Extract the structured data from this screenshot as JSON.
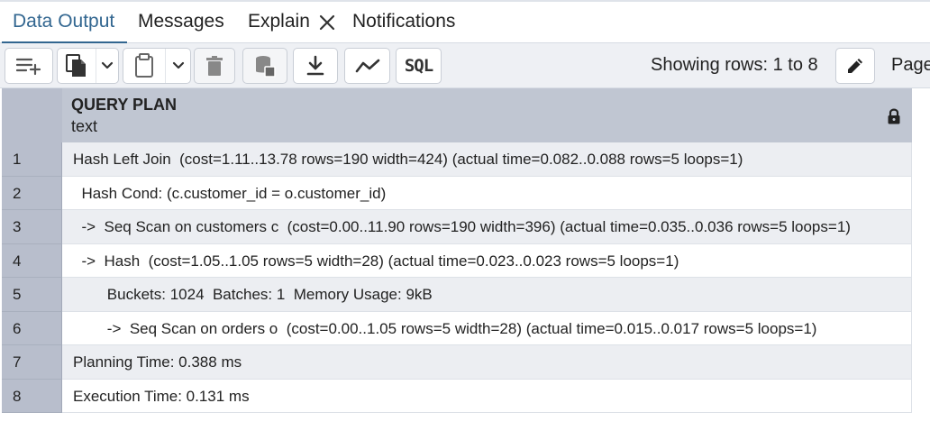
{
  "tabs": [
    {
      "label": "Data Output",
      "active": true
    },
    {
      "label": "Messages"
    },
    {
      "label": "Explain"
    },
    {
      "label": "Notifications"
    }
  ],
  "toolbar": {
    "sql_label": "SQL",
    "status": "Showing rows: 1 to 8",
    "page_label": "Page"
  },
  "grid": {
    "column_name": "QUERY PLAN",
    "column_type": "text",
    "rows": [
      {
        "num": "1",
        "text": "Hash Left Join  (cost=1.11..13.78 rows=190 width=424) (actual time=0.082..0.088 rows=5 loops=1)"
      },
      {
        "num": "2",
        "text": "  Hash Cond: (c.customer_id = o.customer_id)"
      },
      {
        "num": "3",
        "text": "  ->  Seq Scan on customers c  (cost=0.00..11.90 rows=190 width=396) (actual time=0.035..0.036 rows=5 loops=1)"
      },
      {
        "num": "4",
        "text": "  ->  Hash  (cost=1.05..1.05 rows=5 width=28) (actual time=0.023..0.023 rows=5 loops=1)"
      },
      {
        "num": "5",
        "text": "        Buckets: 1024  Batches: 1  Memory Usage: 9kB"
      },
      {
        "num": "6",
        "text": "        ->  Seq Scan on orders o  (cost=0.00..1.05 rows=5 width=28) (actual time=0.015..0.017 rows=5 loops=1)"
      },
      {
        "num": "7",
        "text": "Planning Time: 0.388 ms"
      },
      {
        "num": "8",
        "text": "Execution Time: 0.131 ms"
      }
    ]
  },
  "colors": {
    "accent": "#326690",
    "header_bg": "#b8becc",
    "toolbar_bg": "#eef0f4",
    "stripe": "#eceef2"
  },
  "icons": [
    "add-row-icon",
    "copy-icon",
    "chevron-down-icon",
    "paste-icon",
    "delete-icon",
    "save-data-icon",
    "download-icon",
    "graph-icon",
    "sql-icon",
    "edit-icon",
    "lock-icon",
    "close-icon"
  ]
}
